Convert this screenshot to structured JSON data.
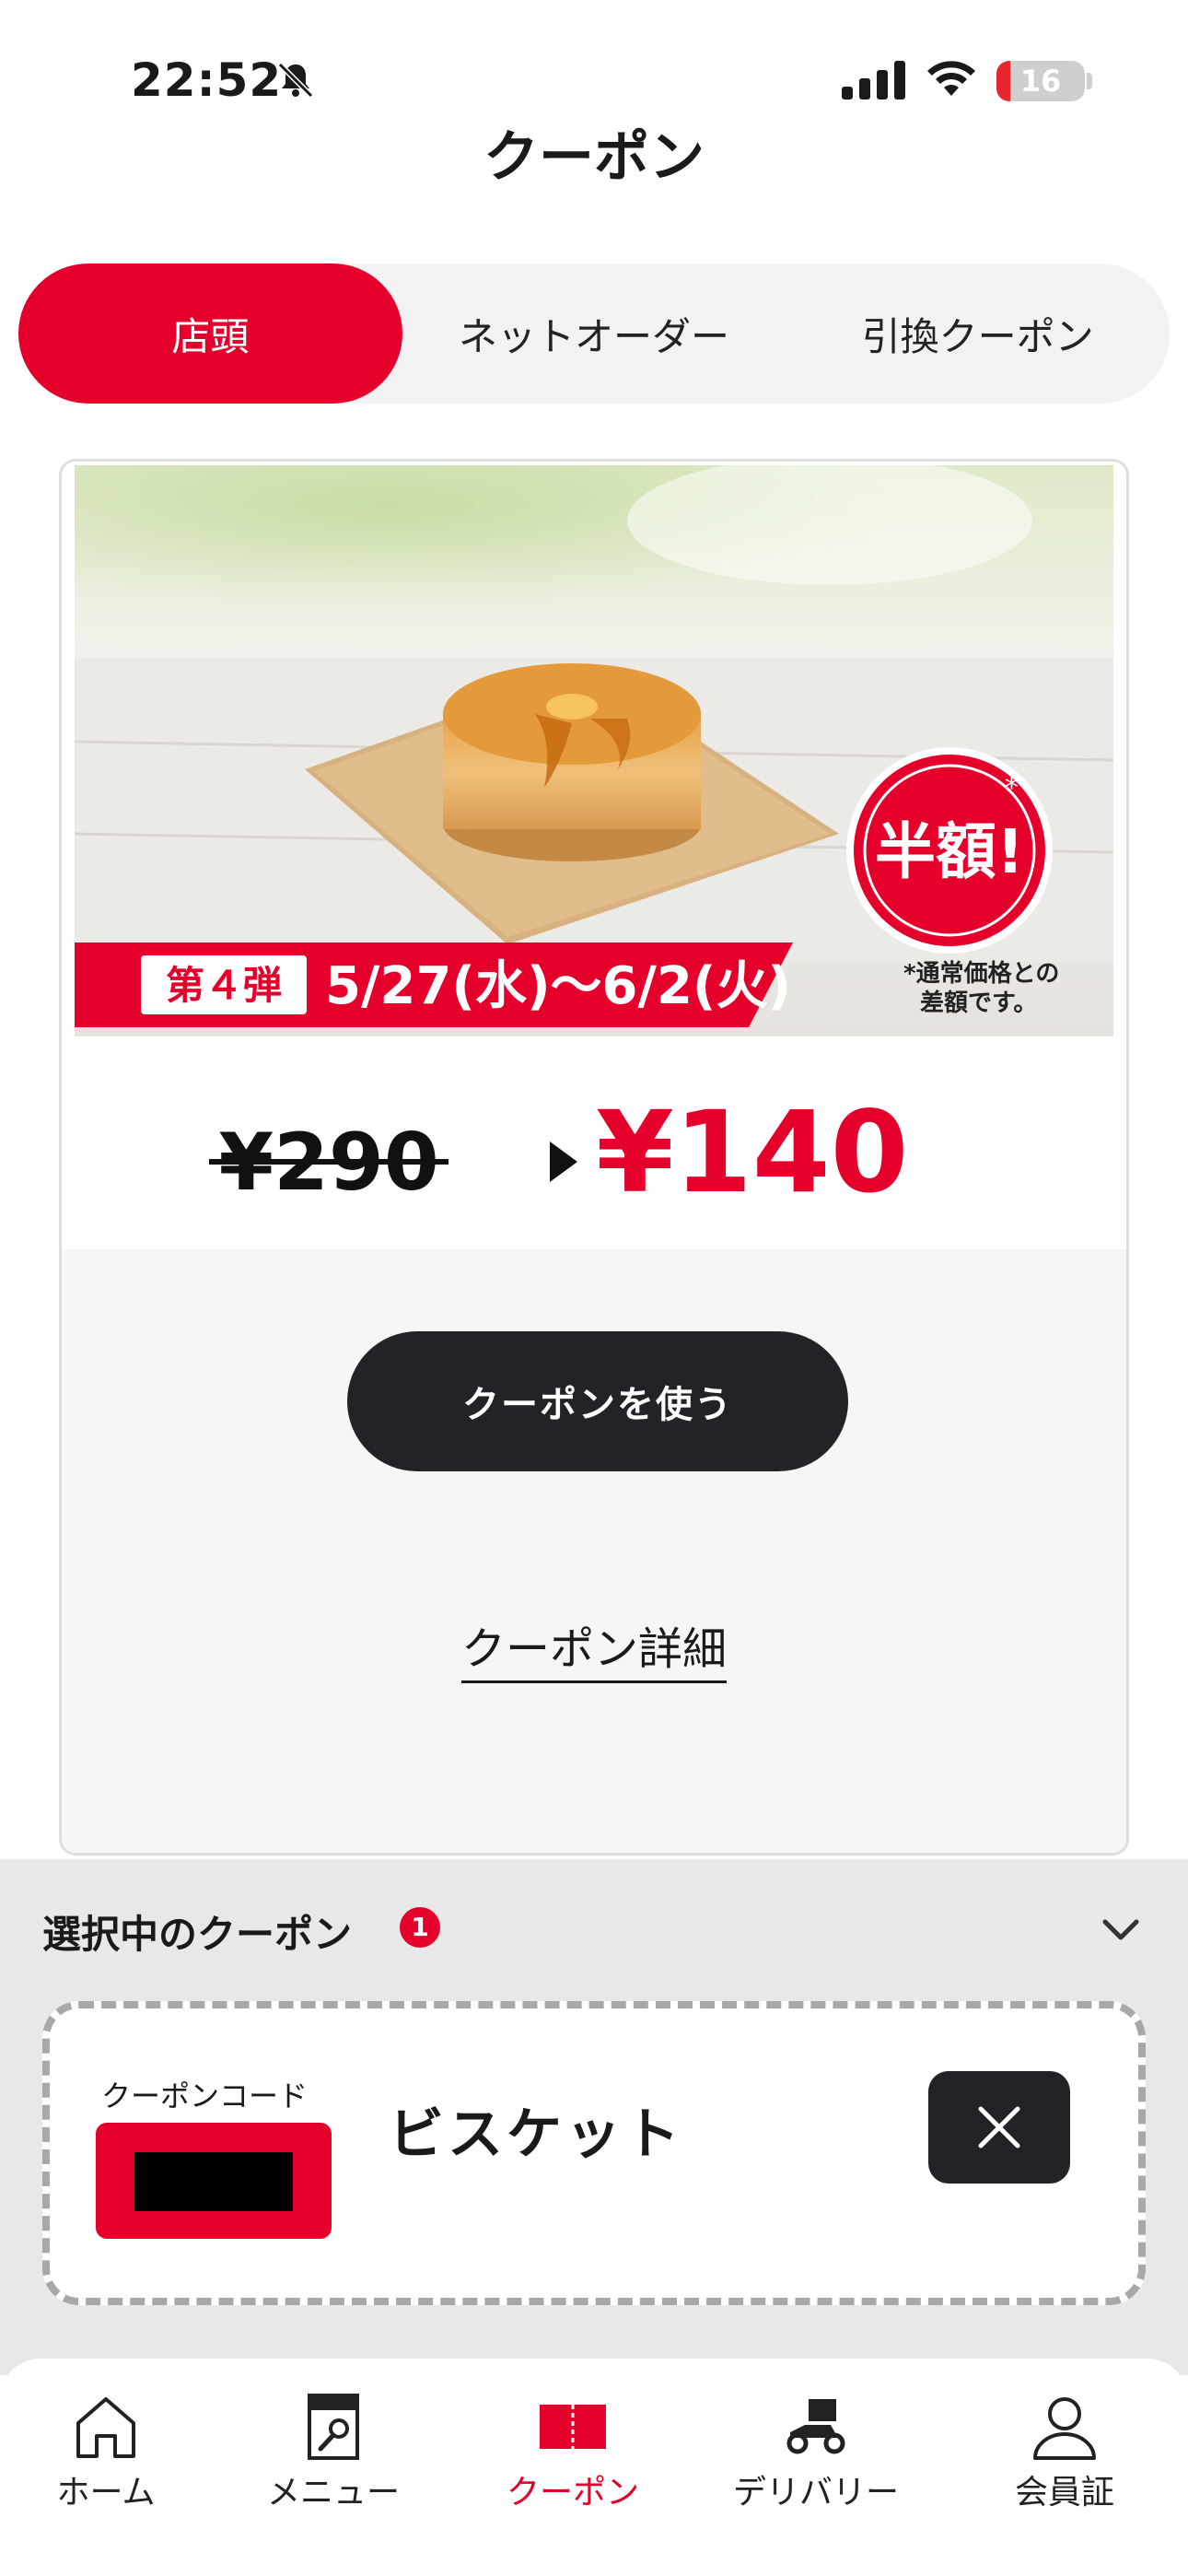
{
  "status_bar": {
    "time": "22:52",
    "battery": "16",
    "battery_level": 0.16
  },
  "header": {
    "title": "クーポン"
  },
  "tabs": [
    {
      "label": "店頭",
      "active": true
    },
    {
      "label": "ネットオーダー",
      "active": false
    },
    {
      "label": "引換クーポン",
      "active": false
    }
  ],
  "coupon": {
    "banner": {
      "badge_text": "半額!",
      "badge_mark": "*",
      "round_label": "第４弾",
      "period": "5/27(水)〜6/2(火)",
      "note_line1": "*通常価格との",
      "note_line2": "差額です。",
      "original_price": "¥290",
      "sale_price": "¥140"
    },
    "name": "ビスケット",
    "detail_link": "クーポン詳細",
    "use_button": "クーポンを使う"
  },
  "selected_coupons": {
    "title": "選択中のクーポン",
    "count": "1",
    "item": {
      "code_label": "クーポンコード",
      "name": "ビスケット"
    }
  },
  "bottom_nav": [
    {
      "label": "ホーム",
      "icon": "home-icon",
      "active": false
    },
    {
      "label": "メニュー",
      "icon": "menu-book-icon",
      "active": false
    },
    {
      "label": "クーポン",
      "icon": "ticket-icon",
      "active": true
    },
    {
      "label": "デリバリー",
      "icon": "delivery-scooter-icon",
      "active": false
    },
    {
      "label": "会員証",
      "icon": "person-icon",
      "active": false
    }
  ],
  "colors": {
    "brand_red": "#e4002b",
    "dark_button": "#222326"
  }
}
